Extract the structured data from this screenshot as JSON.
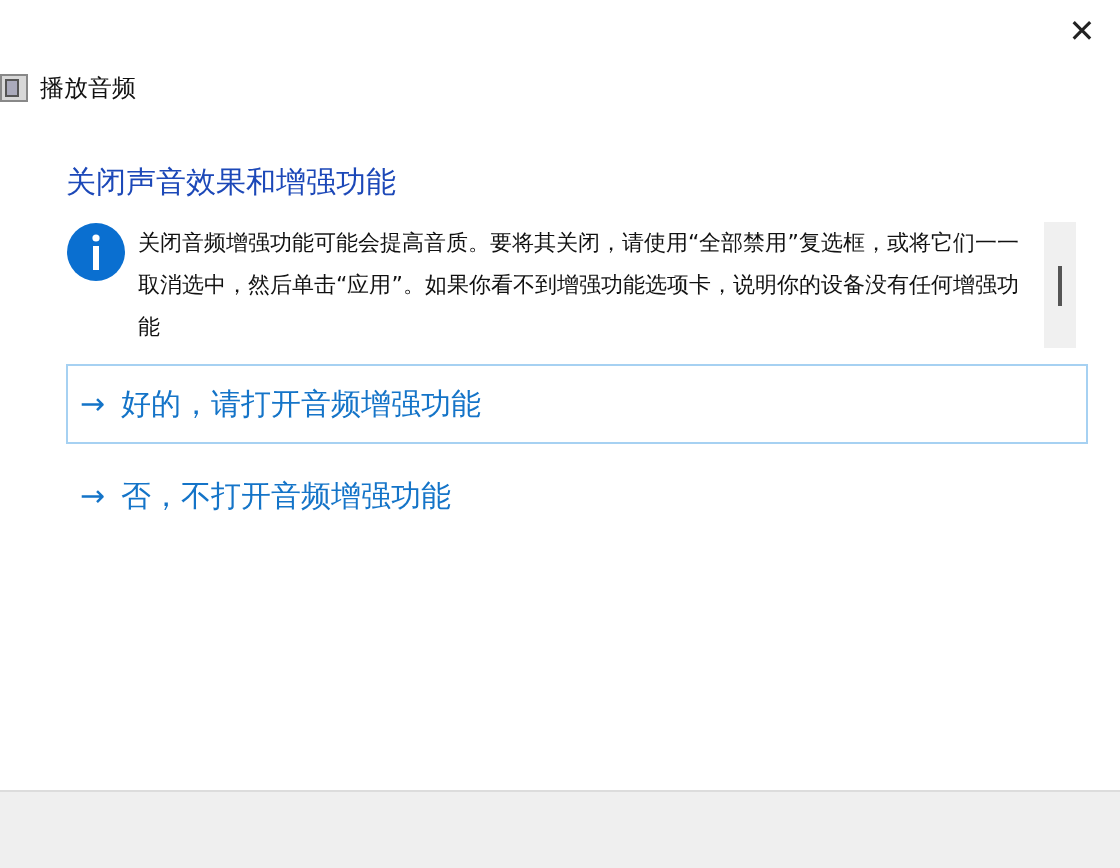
{
  "window": {
    "close_glyph": "✕",
    "app_title": "播放音频"
  },
  "heading": "关闭声音效果和增强功能",
  "info": "关闭音频增强功能可能会提高音质。要将其关闭，请使用“全部禁用”复选框，或将它们一一取消选中，然后单击“应用”。如果你看不到增强功能选项卡，说明你的设备没有任何增强功能",
  "options": [
    {
      "arrow": "→",
      "label": "好的，请打开音频增强功能",
      "selected": true
    },
    {
      "arrow": "→",
      "label": "否，不打开音频增强功能",
      "selected": false
    }
  ]
}
